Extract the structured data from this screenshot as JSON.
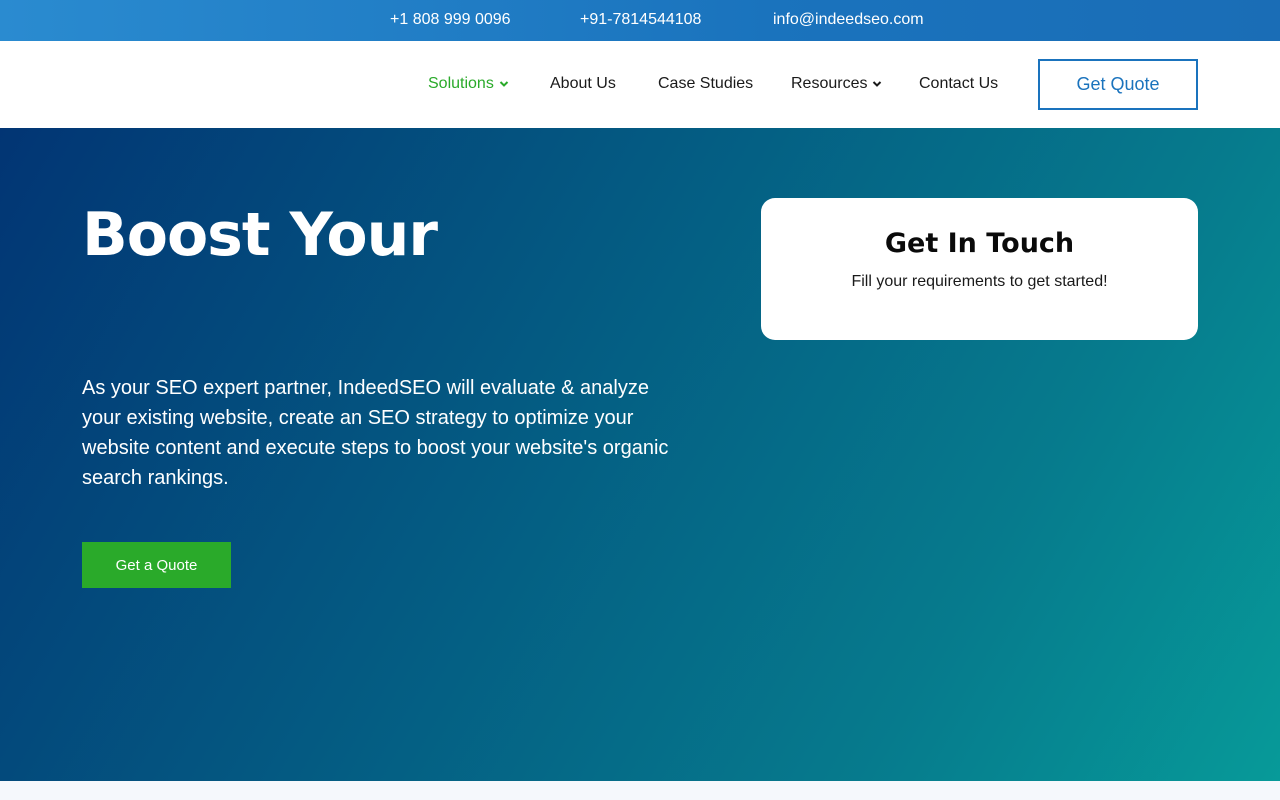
{
  "topbar": {
    "phone_1": "+1 808 999 0096",
    "phone_2": "+91-7814544108",
    "email": "info@indeedseo.com"
  },
  "nav": {
    "items": [
      {
        "label": "Solutions",
        "has_dropdown": true,
        "active": true
      },
      {
        "label": "About Us",
        "has_dropdown": false
      },
      {
        "label": "Case Studies",
        "has_dropdown": false
      },
      {
        "label": "Resources",
        "has_dropdown": true
      },
      {
        "label": "Contact Us",
        "has_dropdown": false
      }
    ],
    "cta_label": "Get Quote"
  },
  "hero": {
    "title": "Boost Your",
    "description": "As your SEO expert partner, IndeedSEO will evaluate & analyze your existing website, create an SEO strategy to optimize your website content and execute steps to boost your website's organic search rankings.",
    "cta_label": "Get a Quote"
  },
  "contact_card": {
    "title": "Get In Touch",
    "subtitle": "Fill your requirements to get started!"
  },
  "colors": {
    "brand_blue": "#1a73bd",
    "accent_green": "#2aaa2a",
    "hero_gradient_start": "#023574",
    "hero_gradient_end": "#079a99"
  },
  "icons": {
    "dropdown": "chevron-down-icon"
  }
}
